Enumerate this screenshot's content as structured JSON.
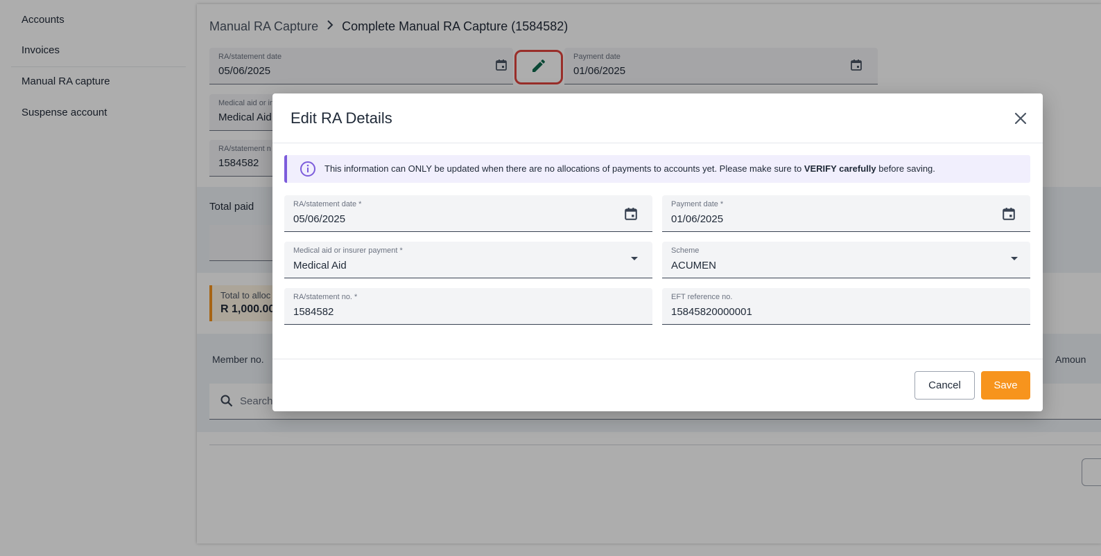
{
  "sidebar": {
    "items": [
      {
        "label": "Accounts"
      },
      {
        "label": "Invoices"
      },
      {
        "label": "Manual RA capture"
      },
      {
        "label": "Suspense account"
      }
    ]
  },
  "breadcrumb": {
    "parent": "Manual RA Capture",
    "separator": ">",
    "current": "Complete Manual RA Capture (1584582)"
  },
  "background_form": {
    "ra_date": {
      "label": "RA/statement date",
      "value": "05/06/2025"
    },
    "payment_date": {
      "label": "Payment date",
      "value": "01/06/2025"
    },
    "medical_aid": {
      "label": "Medical aid or in",
      "value": "Medical Aid"
    },
    "ra_no": {
      "label": "RA/statement n",
      "value": "1584582"
    },
    "total_paid_label": "Total paid",
    "total_alloc": {
      "label": "Total to alloc",
      "value": "R 1,000.00"
    },
    "table": {
      "col_member": "Member no.",
      "col_amount": "Amoun"
    },
    "search_placeholder": "Search"
  },
  "modal": {
    "title": "Edit RA Details",
    "info": {
      "text_before": "This information can ONLY be updated when there are no allocations of payments to accounts yet. Please make sure to ",
      "text_bold": "VERIFY carefully",
      "text_after": " before saving."
    },
    "fields": {
      "ra_date": {
        "label": "RA/statement date *",
        "value": "05/06/2025"
      },
      "payment_date": {
        "label": "Payment date *",
        "value": "01/06/2025"
      },
      "medical_aid": {
        "label": "Medical aid or insurer payment *",
        "value": "Medical Aid"
      },
      "scheme": {
        "label": "Scheme",
        "value": "ACUMEN"
      },
      "ra_no": {
        "label": "RA/statement no. *",
        "value": "1584582"
      },
      "eft_ref": {
        "label": "EFT reference no.",
        "value": "15845820000001"
      }
    },
    "buttons": {
      "cancel": "Cancel",
      "save": "Save"
    }
  },
  "colors": {
    "accent": "#f7941d",
    "info_border": "#7c5cdb",
    "highlight": "#e2453f",
    "edit_icon": "#0f6b4f"
  },
  "icons": {
    "calendar": "calendar-icon",
    "edit": "pencil-icon",
    "close": "close-icon",
    "info": "info-icon",
    "search": "search-icon",
    "dropdown": "caret-down-icon"
  }
}
